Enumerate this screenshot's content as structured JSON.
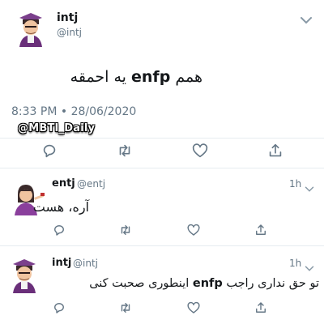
{
  "main_tweet": {
    "name": "intj",
    "handle": "@intj",
    "text_pre": "همم ",
    "text_bold": "enfp",
    "text_post": " یه احمقه",
    "timestamp": "8:33 PM • 28/06/2020"
  },
  "watermark": "@MBTI_Daily",
  "replies": [
    {
      "name": "entj",
      "handle": "@entj",
      "time": "1h",
      "text": "آره، هست"
    },
    {
      "name": "intj",
      "handle": "@intj",
      "time": "1h",
      "text_pre": "تو حق نداری راجب ",
      "text_bold": "enfp",
      "text_post": " اینطوری صحبت کنی"
    }
  ],
  "icons": {
    "reply": "reply-icon",
    "retweet": "retweet-icon",
    "like": "heart-icon",
    "share": "share-icon",
    "more": "chevron-down-icon"
  },
  "colors": {
    "text": "#14171a",
    "muted": "#657786",
    "icon": "#657786",
    "divider": "#e6ecf0"
  }
}
